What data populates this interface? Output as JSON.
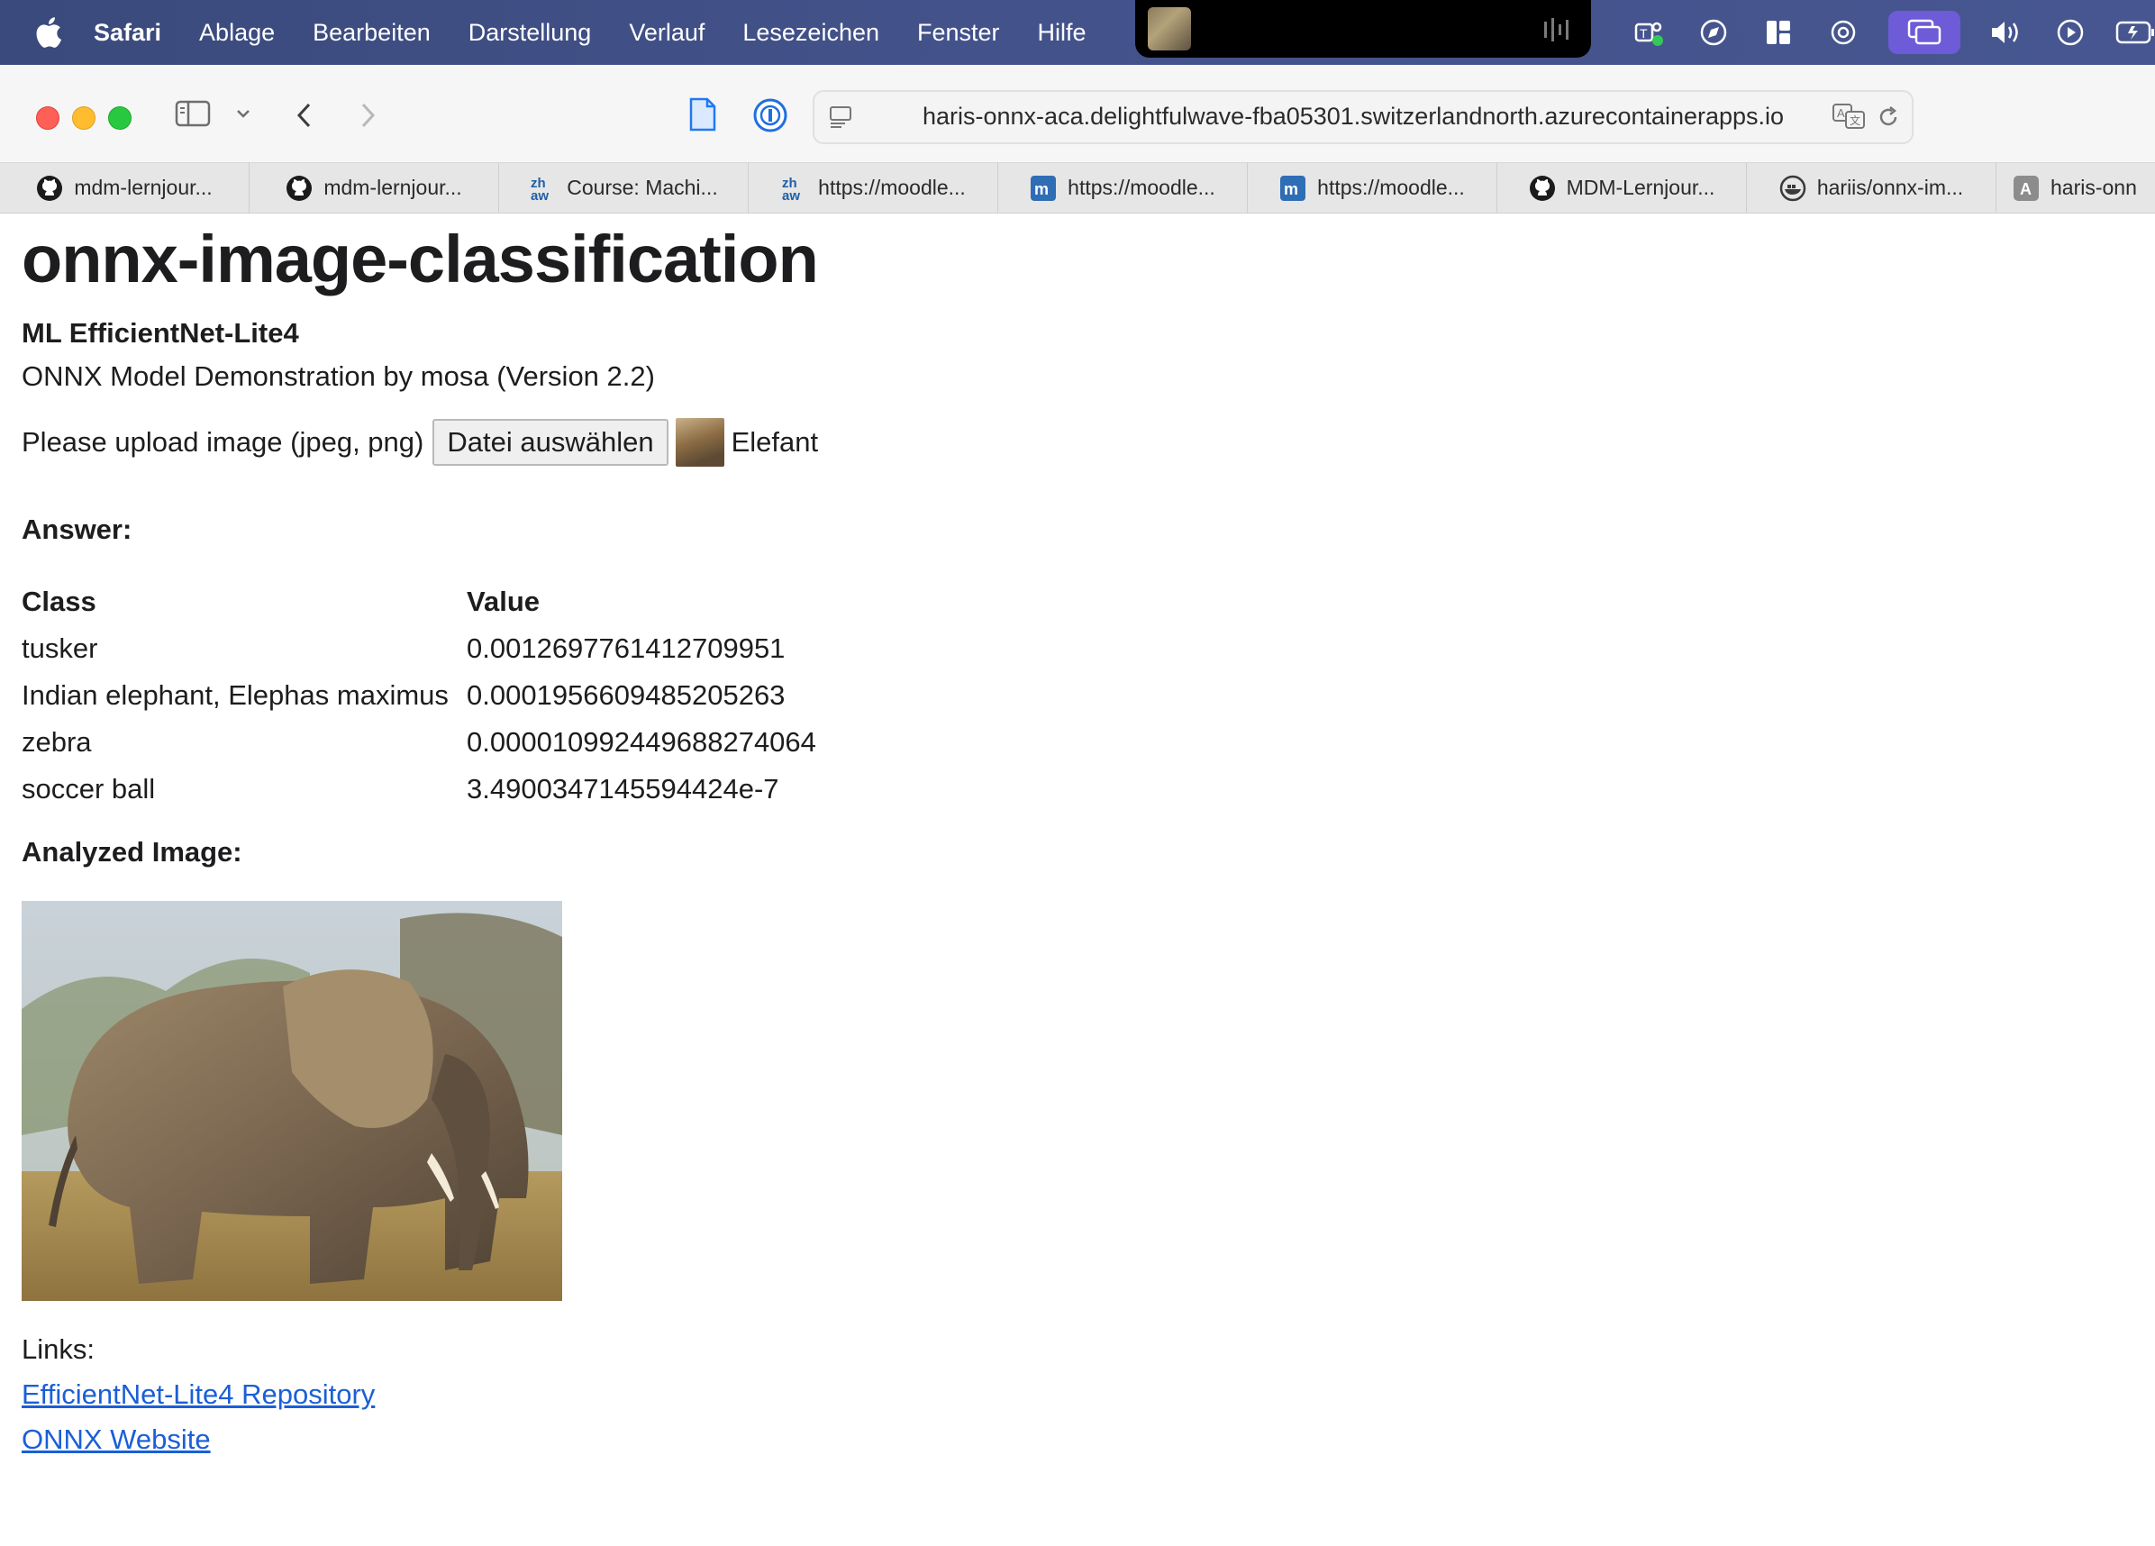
{
  "menubar": {
    "app_name": "Safari",
    "items": [
      "Ablage",
      "Bearbeiten",
      "Darstellung",
      "Verlauf",
      "Lesezeichen",
      "Fenster",
      "Hilfe"
    ],
    "accent_color": "#6d5bd8"
  },
  "toolbar": {
    "url": "haris-onnx-aca.delightfulwave-fba05301.switzerlandnorth.azurecontainerapps.io"
  },
  "tabs": [
    {
      "label": "mdm-lernjour...",
      "icon": "github-icon"
    },
    {
      "label": "mdm-lernjour...",
      "icon": "github-icon"
    },
    {
      "label": "Course: Machi...",
      "icon": "zhaw-icon"
    },
    {
      "label": "https://moodle...",
      "icon": "zhaw-icon"
    },
    {
      "label": "https://moodle...",
      "icon": "moodle-icon"
    },
    {
      "label": "https://moodle...",
      "icon": "moodle-icon"
    },
    {
      "label": "MDM-Lernjour...",
      "icon": "github-icon"
    },
    {
      "label": "hariis/onnx-im...",
      "icon": "docker-icon"
    },
    {
      "label": "haris-onn",
      "icon": "azure-icon"
    }
  ],
  "page": {
    "title": "onnx-image-classification",
    "subtitle": "ML EfficientNet-Lite4",
    "description": "ONNX Model Demonstration by mosa (Version 2.2)",
    "upload_label": "Please upload image (jpeg, png)",
    "file_button": "Datei auswählen",
    "file_name": "Elefant",
    "answer_label": "Answer:",
    "table": {
      "headers": [
        "Class",
        "Value"
      ],
      "rows": [
        [
          "tusker",
          "0.0012697761412709951"
        ],
        [
          "Indian elephant, Elephas maximus",
          "0.0001956609485205263"
        ],
        [
          "zebra",
          "0.000010992449688274064"
        ],
        [
          "soccer ball",
          "3.4900347145594424e-7"
        ]
      ]
    },
    "analyzed_label": "Analyzed Image:",
    "links_label": "Links:",
    "links": [
      "EfficientNet-Lite4 Repository",
      "ONNX Website"
    ],
    "link_color": "#1a5fd6"
  }
}
